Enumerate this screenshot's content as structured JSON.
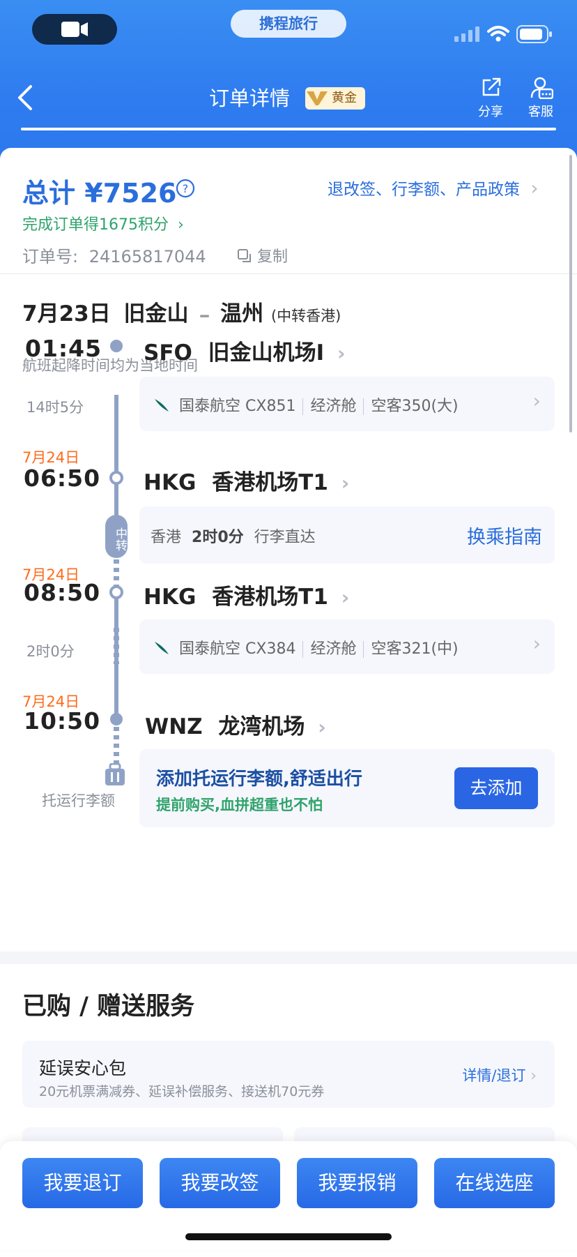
{
  "status_bar": {
    "brand": "携程旅行"
  },
  "nav": {
    "title": "订单详情",
    "badge": "黄金",
    "share_label": "分享",
    "service_label": "客服"
  },
  "summary": {
    "total_prefix": "总计",
    "total_amount": "¥7526",
    "policy_link": "退改签、行李额、产品政策",
    "points_text": "完成订单得1675积分",
    "order_label": "订单号:",
    "order_number": "24165817044",
    "copy_label": "复制"
  },
  "trip": {
    "date": "7月23日",
    "from": "旧金山",
    "to": "温州",
    "via": "(中转香港)",
    "time_note": "航班起降时间均为当地时间",
    "stops": [
      {
        "date": "",
        "time": "01:45",
        "code": "SFO",
        "name": "旧金山机场I"
      },
      {
        "date": "7月24日",
        "time": "06:50",
        "code": "HKG",
        "name": "香港机场T1"
      },
      {
        "date": "7月24日",
        "time": "08:50",
        "code": "HKG",
        "name": "香港机场T1"
      },
      {
        "date": "7月24日",
        "time": "10:50",
        "code": "WNZ",
        "name": "龙湾机场"
      }
    ],
    "segments": [
      {
        "duration": "14时5分",
        "airline": "国泰航空",
        "flight_no": "CX851",
        "cabin": "经济舱",
        "aircraft": "空客350(大)"
      },
      {
        "duration": "2时0分",
        "airline": "国泰航空",
        "flight_no": "CX384",
        "cabin": "经济舱",
        "aircraft": "空客321(中)"
      }
    ],
    "transfer": {
      "tag": "中转",
      "city": "香港",
      "duration": "2时0分",
      "baggage": "行李直达",
      "guide_link": "换乘指南"
    },
    "baggage_promo": {
      "icon_label": "托运行李额",
      "title": "添加托运行李额,舒适出行",
      "subtitle": "提前购买,血拼超重也不怕",
      "button": "去添加"
    }
  },
  "services": {
    "heading": "已购 / 赠送服务",
    "items": [
      {
        "title": "延误安心包",
        "desc": "20元机票满减券、延误补偿服务、接送机70元券",
        "link": "详情/退订"
      }
    ]
  },
  "bottom_actions": [
    "我要退订",
    "我要改签",
    "我要报销",
    "在线选座"
  ]
}
